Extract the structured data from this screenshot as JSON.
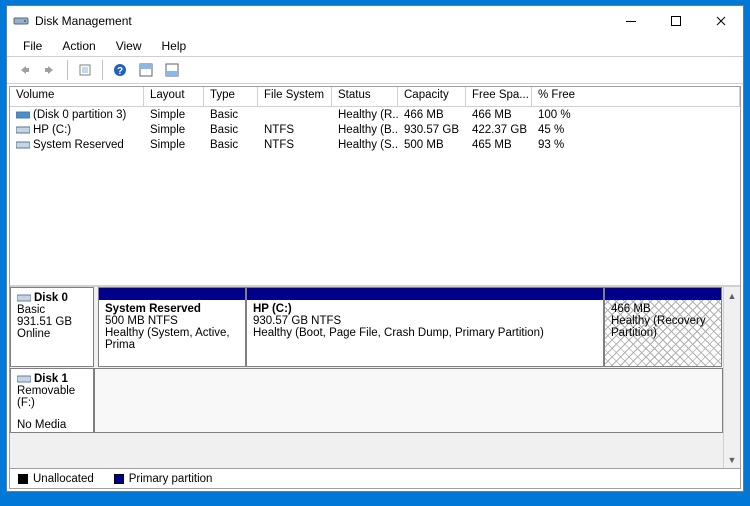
{
  "title": "Disk Management",
  "menus": [
    "File",
    "Action",
    "View",
    "Help"
  ],
  "columns": {
    "volume": "Volume",
    "layout": "Layout",
    "type": "Type",
    "fs": "File System",
    "status": "Status",
    "capacity": "Capacity",
    "free": "Free Spa...",
    "pct": "% Free"
  },
  "volumes": [
    {
      "name": "(Disk 0 partition 3)",
      "layout": "Simple",
      "type": "Basic",
      "fs": "",
      "status": "Healthy (R...",
      "cap": "466 MB",
      "free": "466 MB",
      "pct": "100 %",
      "icon": "drive-blue"
    },
    {
      "name": "HP (C:)",
      "layout": "Simple",
      "type": "Basic",
      "fs": "NTFS",
      "status": "Healthy (B...",
      "cap": "930.57 GB",
      "free": "422.37 GB",
      "pct": "45 %",
      "icon": "drive"
    },
    {
      "name": "System Reserved",
      "layout": "Simple",
      "type": "Basic",
      "fs": "NTFS",
      "status": "Healthy (S...",
      "cap": "500 MB",
      "free": "465 MB",
      "pct": "93 %",
      "icon": "drive"
    }
  ],
  "disk0": {
    "title": "Disk 0",
    "type": "Basic",
    "size": "931.51 GB",
    "state": "Online",
    "parts": [
      {
        "title": "System Reserved",
        "line2": "500 MB NTFS",
        "line3": "Healthy (System, Active, Prima"
      },
      {
        "title": "HP  (C:)",
        "line2": "930.57 GB NTFS",
        "line3": "Healthy (Boot, Page File, Crash Dump, Primary Partition)"
      },
      {
        "title": "",
        "line2": "466 MB",
        "line3": "Healthy (Recovery Partition)"
      }
    ]
  },
  "disk1": {
    "title": "Disk 1",
    "type": "Removable (F:)",
    "state": "No Media"
  },
  "legend": {
    "unalloc": "Unallocated",
    "primary": "Primary partition"
  }
}
